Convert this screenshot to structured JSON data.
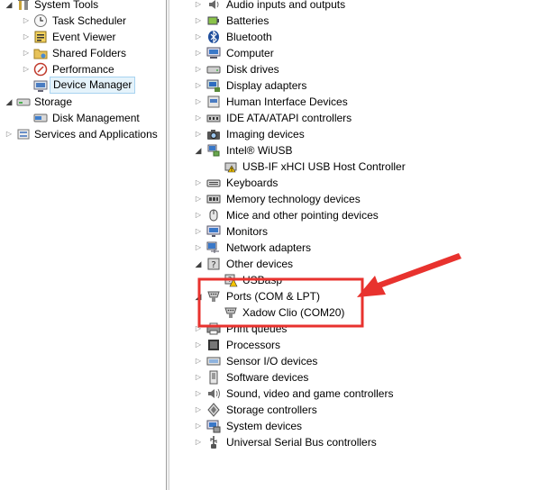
{
  "left_tree": {
    "items": [
      {
        "label": "System Tools",
        "icon": "tools-icon",
        "expanded": true
      },
      {
        "label": "Task Scheduler",
        "icon": "clock-icon"
      },
      {
        "label": "Event Viewer",
        "icon": "event-viewer-icon"
      },
      {
        "label": "Shared Folders",
        "icon": "shared-folder-icon"
      },
      {
        "label": "Performance",
        "icon": "performance-icon"
      },
      {
        "label": "Device Manager",
        "icon": "device-manager-icon",
        "selected": true
      },
      {
        "label": "Storage",
        "icon": "storage-icon",
        "expanded": true
      },
      {
        "label": "Disk Management",
        "icon": "disk-management-icon"
      },
      {
        "label": "Services and Applications",
        "icon": "services-icon"
      }
    ]
  },
  "device_tree": {
    "items": [
      {
        "label": "Audio inputs and outputs",
        "icon": "speaker-icon"
      },
      {
        "label": "Batteries",
        "icon": "battery-icon"
      },
      {
        "label": "Bluetooth",
        "icon": "bluetooth-icon"
      },
      {
        "label": "Computer",
        "icon": "computer-icon"
      },
      {
        "label": "Disk drives",
        "icon": "disk-drive-icon"
      },
      {
        "label": "Display adapters",
        "icon": "display-adapter-icon"
      },
      {
        "label": "Human Interface Devices",
        "icon": "hid-icon"
      },
      {
        "label": "IDE ATA/ATAPI controllers",
        "icon": "ide-controller-icon"
      },
      {
        "label": "Imaging devices",
        "icon": "camera-icon"
      },
      {
        "label": "Intel® WiUSB",
        "icon": "network-icon",
        "expanded": true
      },
      {
        "label": "USB-IF xHCI USB Host Controller",
        "icon": "usb-controller-warning-icon",
        "child": true
      },
      {
        "label": "Keyboards",
        "icon": "keyboard-icon"
      },
      {
        "label": "Memory technology devices",
        "icon": "memory-icon"
      },
      {
        "label": "Mice and other pointing devices",
        "icon": "mouse-icon"
      },
      {
        "label": "Monitors",
        "icon": "monitor-icon"
      },
      {
        "label": "Network adapters",
        "icon": "network-adapter-icon"
      },
      {
        "label": "Other devices",
        "icon": "other-devices-icon",
        "expanded": true
      },
      {
        "label": "USBasp",
        "icon": "unknown-device-warning-icon",
        "child": true
      },
      {
        "label": "Ports (COM & LPT)",
        "icon": "port-icon",
        "expanded": true
      },
      {
        "label": "Xadow Clio (COM20)",
        "icon": "port-icon",
        "child": true
      },
      {
        "label": "Print queues",
        "icon": "printer-icon"
      },
      {
        "label": "Processors",
        "icon": "processor-icon"
      },
      {
        "label": "Sensor I/O devices",
        "icon": "sensor-icon"
      },
      {
        "label": "Software devices",
        "icon": "software-device-icon"
      },
      {
        "label": "Sound, video and game controllers",
        "icon": "sound-icon"
      },
      {
        "label": "Storage controllers",
        "icon": "storage-controller-icon"
      },
      {
        "label": "System devices",
        "icon": "system-devices-icon"
      },
      {
        "label": "Universal Serial Bus controllers",
        "icon": "usb-icon"
      }
    ]
  },
  "annotation": {
    "color": "#e8322e"
  }
}
